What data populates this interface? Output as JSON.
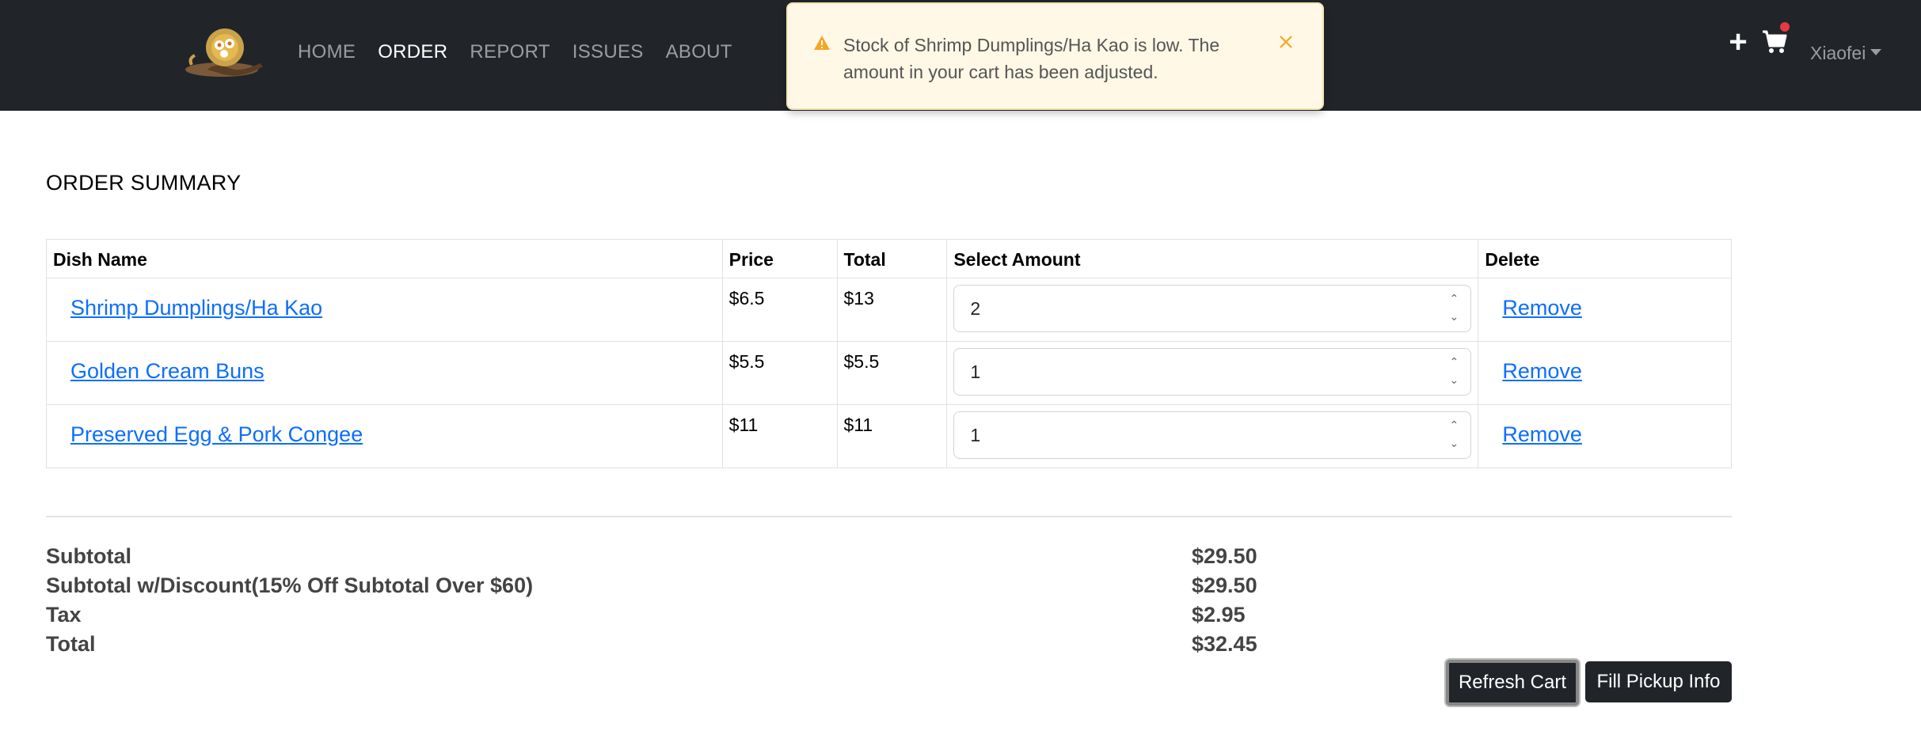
{
  "nav": {
    "links": [
      "HOME",
      "ORDER",
      "REPORT",
      "ISSUES",
      "ABOUT"
    ],
    "active": "ORDER",
    "user": "Xiaofei",
    "icons": [
      "plus-icon",
      "cart-icon",
      "chevron-down-icon"
    ],
    "cart_notification_color": "#e63946"
  },
  "toast": {
    "message": "Stock of Shrimp Dumplings/Ha Kao is low. The amount in your cart has been adjusted.",
    "icon": "warning-icon",
    "accent_color": "#f5a623"
  },
  "order": {
    "title": "ORDER SUMMARY",
    "columns": [
      "Dish Name",
      "Price",
      "Total",
      "Select Amount",
      "Delete"
    ],
    "rows": [
      {
        "name": "Shrimp Dumplings/Ha Kao",
        "price": "$6.5",
        "total": "$13",
        "amount": "2",
        "delete": "Remove"
      },
      {
        "name": "Golden Cream Buns",
        "price": "$5.5",
        "total": "$5.5",
        "amount": "1",
        "delete": "Remove"
      },
      {
        "name": "Preserved Egg & Pork Congee",
        "price": "$11",
        "total": "$11",
        "amount": "1",
        "delete": "Remove"
      }
    ]
  },
  "summary": {
    "subtotal_label": "Subtotal",
    "subtotal_value": "$29.50",
    "discount_label": "Subtotal w/Discount(15% Off Subtotal Over $60)",
    "discount_value": "$29.50",
    "tax_label": "Tax",
    "tax_value": "$2.95",
    "total_label": "Total",
    "total_value": "$32.45"
  },
  "actions": {
    "refresh_label": "Refresh Cart",
    "pickup_label": "Fill Pickup Info"
  }
}
